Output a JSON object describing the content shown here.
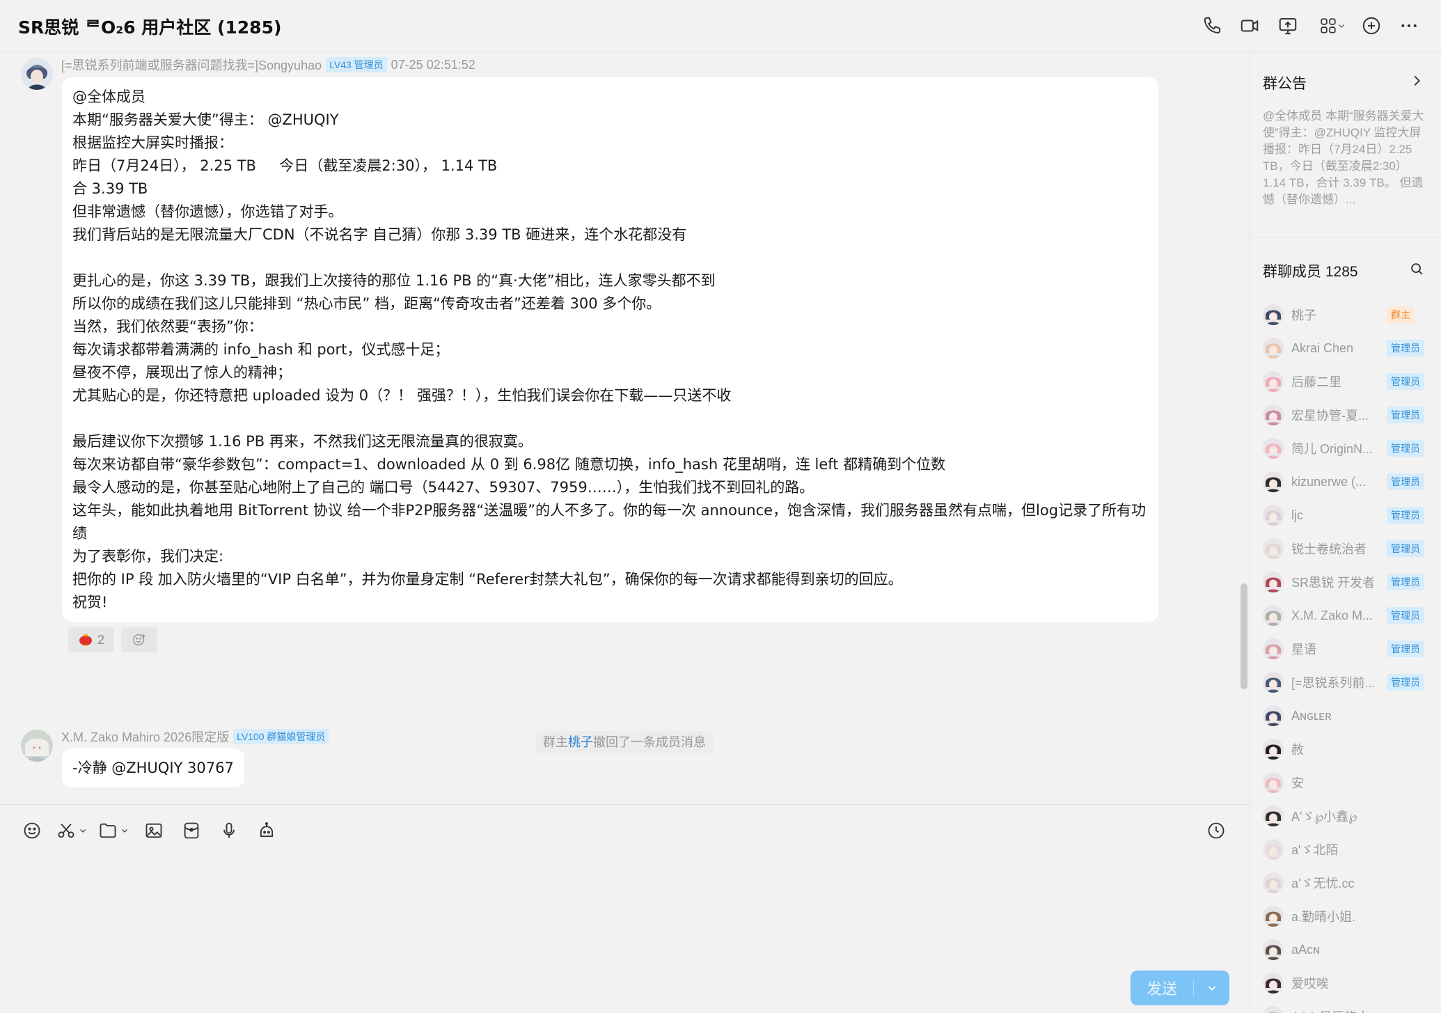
{
  "header": {
    "title": "SR思锐 ᄅO₂6 用户社区 (1285)",
    "icons": [
      "phone-icon",
      "video-icon",
      "screen-share-icon",
      "apps-icon",
      "add-icon",
      "more-icon"
    ]
  },
  "messages": [
    {
      "sender": "[=思锐系列前端或服务器问题找我=]Songyuhao",
      "badge": "LV43 管理员",
      "time": "07-25 02:51:52",
      "lines": [
        "@全体成员",
        "本期“服务器关爱大使”得主： @ZHUQIY",
        "根据监控大屏实时播报：",
        "昨日（7月24日）， 2.25 TB     今日（截至凌晨2:30）， 1.14 TB",
        "合 3.39 TB",
        "但非常遗憾（替你遗憾），你选错了对手。",
        "我们背后站的是无限流量大厂CDN（不说名字 自己猜）你那 3.39 TB 砸进来，连个水花都没有",
        "",
        "更扎心的是，你这 3.39 TB，跟我们上次接待的那位 1.16 PB 的“真·大佬”相比，连人家零头都不到",
        "所以你的成绩在我们这儿只能排到 “热心市民” 档，距离“传奇攻击者”还差着 300 多个你。",
        "当然，我们依然要“表扬”你：",
        "每次请求都带着满满的 info_hash 和 port，仪式感十足；",
        "昼夜不停，展现出了惊人的精神；",
        "尤其贴心的是，你还特意把 uploaded 设为 0（？！ 强强？！），生怕我们误会你在下载——只送不收",
        "",
        "最后建议你下次攒够 1.16 PB 再来，不然我们这无限流量真的很寂寞。",
        "每次来访都自带“豪华参数包”：compact=1、downloaded 从 0 到 6.98亿 随意切换，info_hash 花里胡哨，连 left 都精确到个位数",
        "最令人感动的是，你甚至贴心地附上了自己的 端口号（54427、59307、7959……），生怕我们找不到回礼的路。",
        "这年头，能如此执着地用 BitTorrent 协议 给一个非P2P服务器“送温暖”的人不多了。你的每一次 announce，饱含深情，我们服务器虽然有点喘，但log记录了所有功绩",
        "为了表彰你，我们决定:",
        "把你的 IP 段 加入防火墙里的“VIP 白名单”，并为你量身定制 “Referer封禁大礼包”，确保你的每一次请求都能得到亲切的回应。",
        "祝贺!"
      ],
      "reaction_count": "2"
    },
    {
      "sender": "X.M. Zako Mahiro 2026限定版",
      "badge": "LV100 群猫娘管理员",
      "text": "-冷静 @ZHUQIY 30767"
    }
  ],
  "system_note": {
    "prefix": "群主",
    "owner": "桃子",
    "suffix": "撤回了一条成员消息"
  },
  "composer": {
    "tools": [
      "emoji-icon",
      "scissors-icon",
      "folder-icon",
      "image-icon",
      "red-packet-icon",
      "mic-icon",
      "bot-icon"
    ],
    "send_label": "发送"
  },
  "sidebar": {
    "notice_title": "群公告",
    "notice_text": "@全体成员 本期“服务器关爱大使”得主：@ZHUQIY 监控大屏播报：昨日（7月24日）2.25 TB，今日（截至凌晨2:30）1.14 TB，合计 3.39 TB。 但遗憾（替你遗憾）...",
    "members_title": "群聊成员 1285",
    "members": [
      {
        "name": "桃子",
        "badge": "群主",
        "color": "#3b4a66"
      },
      {
        "name": "Akrai Chen",
        "badge": "管理员",
        "color": "#e8c4b0"
      },
      {
        "name": "后藤二里",
        "badge": "管理员",
        "color": "#f2a7b8"
      },
      {
        "name": "宏星协管-夏...",
        "badge": "管理员",
        "color": "#c98aa0"
      },
      {
        "name": "简儿 OriginN...",
        "badge": "管理员",
        "color": "#f0b4c0"
      },
      {
        "name": "kizunerwe (...",
        "badge": "管理员",
        "color": "#2c2c2c"
      },
      {
        "name": "ljc",
        "badge": "管理员",
        "color": "#d8d0d8"
      },
      {
        "name": "锐士卷统治者",
        "badge": "管理员",
        "color": "#e0d8d0"
      },
      {
        "name": "SR思锐 开发者",
        "badge": "管理员",
        "color": "#b0485a"
      },
      {
        "name": "X.M. Zako M...",
        "badge": "管理员",
        "color": "#a8b0a8"
      },
      {
        "name": "星语",
        "badge": "管理员",
        "color": "#d8a0a8"
      },
      {
        "name": "[=思锐系列前...",
        "badge": "管理员",
        "color": "#4a5a78"
      },
      {
        "name": "Aɴɢʟᴇʀ",
        "badge": "",
        "color": "#404868"
      },
      {
        "name": "赦",
        "badge": "",
        "color": "#222222"
      },
      {
        "name": "安",
        "badge": "",
        "color": "#f0b8c0"
      },
      {
        "name": "A'ゞ℘小鑫℘",
        "badge": "",
        "color": "#303030"
      },
      {
        "name": "a'ゞ北陌",
        "badge": "",
        "color": "#e8d8e0"
      },
      {
        "name": "a'ゞ无忧.cc",
        "badge": "",
        "color": "#e0d0d8"
      },
      {
        "name": "a.勤晴小姐.",
        "badge": "",
        "color": "#8a6a50"
      },
      {
        "name": "aAᴄɴ",
        "badge": "",
        "color": "#5a5050"
      },
      {
        "name": "爱哎唉",
        "badge": "",
        "color": "#3a2a30"
      },
      {
        "name": "AAA 星辰旅人",
        "badge": "",
        "color": "#c0b8c8"
      }
    ]
  }
}
